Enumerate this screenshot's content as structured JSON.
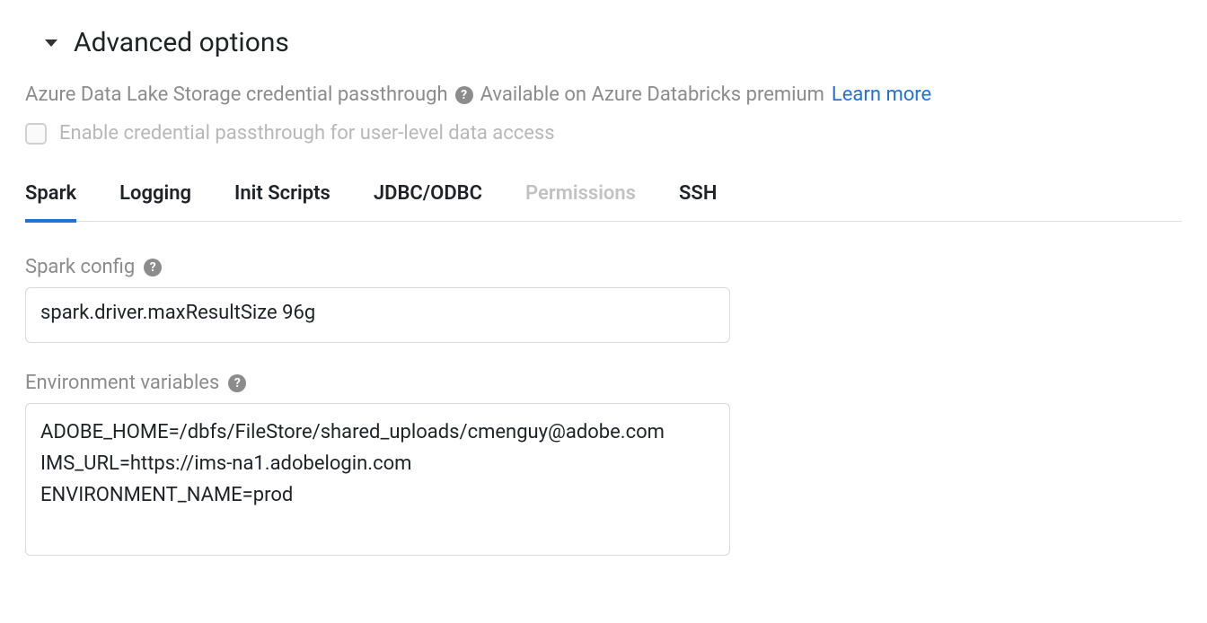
{
  "section": {
    "title": "Advanced options"
  },
  "credential": {
    "label": "Azure Data Lake Storage credential passthrough",
    "availability": "Available on Azure Databricks premium",
    "learn_more": "Learn more"
  },
  "checkbox": {
    "label": "Enable credential passthrough for user-level data access"
  },
  "tabs": [
    {
      "label": "Spark",
      "active": true,
      "disabled": false
    },
    {
      "label": "Logging",
      "active": false,
      "disabled": false
    },
    {
      "label": "Init Scripts",
      "active": false,
      "disabled": false
    },
    {
      "label": "JDBC/ODBC",
      "active": false,
      "disabled": false
    },
    {
      "label": "Permissions",
      "active": false,
      "disabled": true
    },
    {
      "label": "SSH",
      "active": false,
      "disabled": false
    }
  ],
  "spark_config": {
    "label": "Spark config",
    "value": "spark.driver.maxResultSize 96g"
  },
  "env_vars": {
    "label": "Environment variables",
    "value": "ADOBE_HOME=/dbfs/FileStore/shared_uploads/cmenguy@adobe.com\nIMS_URL=https://ims-na1.adobelogin.com\nENVIRONMENT_NAME=prod"
  }
}
